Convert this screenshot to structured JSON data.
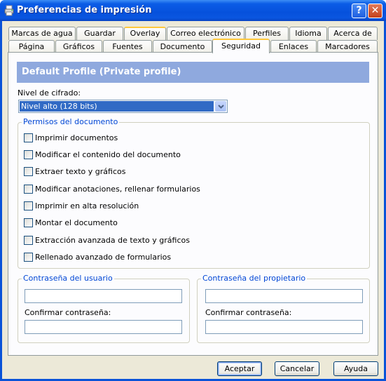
{
  "window": {
    "title": "Preferencias de impresión",
    "help_glyph": "?",
    "close_glyph": "✕"
  },
  "tabs_row1": [
    "Marcas de agua",
    "Guardar",
    "Overlay",
    "Correo electrónico",
    "Perfiles",
    "Idioma",
    "Acerca de"
  ],
  "tabs_row2": [
    "Página",
    "Gráficos",
    "Fuentes",
    "Documento",
    "Seguridad",
    "Enlaces",
    "Marcadores"
  ],
  "active_tab": "Seguridad",
  "security": {
    "profile_title": "Default Profile (Private profile)",
    "encryption_label": "Nivel de cifrado:",
    "encryption_value": "Nivel alto (128 bits)",
    "permissions_title": "Permisos del documento",
    "permissions": [
      {
        "label": "Imprimir documentos",
        "checked": false
      },
      {
        "label": "Modificar el contenido del documento",
        "checked": false
      },
      {
        "label": "Extraer texto y gráficos",
        "checked": false
      },
      {
        "label": "Modificar anotaciones, rellenar formularios",
        "checked": false
      },
      {
        "label": "Imprimir en alta resolución",
        "checked": false
      },
      {
        "label": "Montar el documento",
        "checked": false
      },
      {
        "label": "Extracción avanzada de texto y gráficos",
        "checked": false
      },
      {
        "label": "Rellenado avanzado de formularios",
        "checked": false
      }
    ],
    "user_password": {
      "title": "Contraseña del usuario",
      "value": "",
      "confirm_label": "Confirmar contraseña:",
      "confirm_value": ""
    },
    "owner_password": {
      "title": "Contraseña del propietario",
      "value": "",
      "confirm_label": "Confirmar contraseña:",
      "confirm_value": ""
    }
  },
  "buttons": {
    "ok": "Aceptar",
    "cancel": "Cancelar",
    "help": "Ayuda"
  },
  "colors": {
    "titlebar": "#0651dc",
    "face": "#ece9d8",
    "profile_bar": "#8fa9de",
    "group_title": "#0046d5",
    "selection": "#316ac5"
  },
  "icons": {
    "title": "printer-icon",
    "dropdown": "chevron-down-icon"
  }
}
